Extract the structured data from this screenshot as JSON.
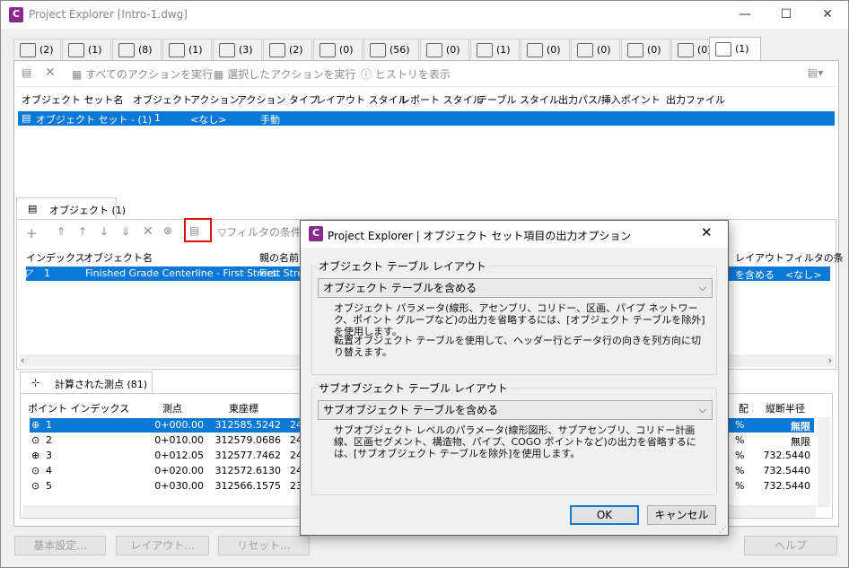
{
  "window": {
    "title": "Project Explorer [Intro-1.dwg]",
    "app_icon": "C",
    "min": "—",
    "max": "☐",
    "close": "✕"
  },
  "tabs": [
    {
      "count": "(2)"
    },
    {
      "count": "(1)"
    },
    {
      "count": "(8)"
    },
    {
      "count": "(1)"
    },
    {
      "count": "(3)"
    },
    {
      "count": "(2)"
    },
    {
      "count": "(0)"
    },
    {
      "count": "(56)"
    },
    {
      "count": "(0)"
    },
    {
      "count": "(1)"
    },
    {
      "count": "(0)"
    },
    {
      "count": "(0)"
    },
    {
      "count": "(0)"
    },
    {
      "count": "(0)"
    },
    {
      "count": "(1)"
    }
  ],
  "toolbar": {
    "run_all": "すべてのアクションを実行",
    "run_selected": "選択したアクションを実行",
    "show_history": "ヒストリを表示"
  },
  "objset_columns": [
    "オブジェクト セット名",
    "オブジェクト",
    "アクション",
    "アクション タイプ",
    "レイアウト スタイル",
    "レポート スタイル",
    "テーブル スタイル",
    "出力パス/挿入ポイント",
    "出力ファイル"
  ],
  "objset_row": {
    "name": "オブジェクト セット - (1)",
    "objects": "1",
    "action": "<なし>",
    "action_type": "手動"
  },
  "objects_tab": {
    "label": "オブジェクト (1)",
    "filter": "フィルタの条件"
  },
  "objects_columns": {
    "index": "インデックス",
    "name": "オブジェクト名",
    "parent": "親の名前",
    "layout": "レイアウト",
    "filter": "フィルタの条"
  },
  "objects_row": {
    "index": "1",
    "name": "Finished Grade Centerline - First Street",
    "parent": "First Street",
    "layout": "を含める",
    "filter": "<なし>"
  },
  "points_tab": {
    "label": "計算された測点 (81)"
  },
  "points_columns": {
    "index": "ポイント インデックス",
    "station": "測点",
    "easting": "東座標",
    "grade": "配",
    "radius": "縦断半径"
  },
  "points_rows": [
    {
      "index": "1",
      "station": "0+000.00",
      "easting": "312585.5242",
      "n": "2401",
      "g": "%",
      "radius": "無限"
    },
    {
      "index": "2",
      "station": "0+010.00",
      "easting": "312579.0686",
      "n": "2400",
      "g": "%",
      "radius": "無限"
    },
    {
      "index": "3",
      "station": "0+012.05",
      "easting": "312577.7462",
      "n": "2400",
      "g": "%",
      "radius": "732.5440"
    },
    {
      "index": "4",
      "station": "0+020.00",
      "easting": "312572.6130",
      "n": "2400",
      "g": "%",
      "radius": "732.5440"
    },
    {
      "index": "5",
      "station": "0+030.00",
      "easting": "312566.1575",
      "n": "2399",
      "g": "%",
      "radius": "732.5440"
    }
  ],
  "bottom_buttons": {
    "settings": "基本設定...",
    "layout": "レイアウト...",
    "reset": "リセット...",
    "help": "ヘルプ"
  },
  "dialog": {
    "title": "Project Explorer | オブジェクト セット項目の出力オプション",
    "close": "✕",
    "group1": {
      "label": "オブジェクト テーブル レイアウト",
      "combo": "オブジェクト テーブルを含める",
      "desc1": "オブジェクト パラメータ(線形、アセンブリ、コリドー、区画、パイプ ネットワーク、ポイント グループなど)の出力を省略するには、[オブジェクト テーブルを除外]を使用します。",
      "desc2": "転置オブジェクト テーブルを使用して、ヘッダー行とデータ行の向きを列方向に切り替えます。"
    },
    "group2": {
      "label": "サブオブジェクト テーブル レイアウト",
      "combo": "サブオブジェクト テーブルを含める",
      "desc": "サブオブジェクト レベルのパラメータ(線形図形、サブアセンブリ、コリドー計画線、区画セグメント、構造物、パイプ、COGO ポイントなど)の出力を省略するには、[サブオブジェクト テーブルを除外]を使用します。"
    },
    "ok": "OK",
    "cancel": "キャンセル"
  },
  "colors": {
    "accent": "#0a78d7",
    "highlight": "#e01010",
    "app_icon": "#8a2a8e"
  }
}
